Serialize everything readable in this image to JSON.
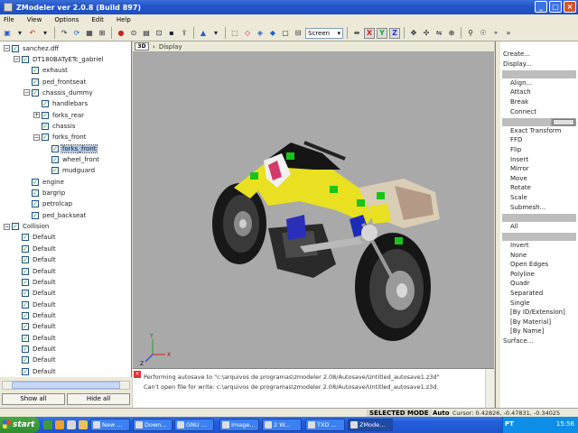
{
  "window": {
    "title": "ZModeler ver 2.0.8 (Build 897)"
  },
  "menu": [
    "File",
    "View",
    "Options",
    "Edit",
    "Help"
  ],
  "toolbar": {
    "screen_select": "Screen",
    "axis_x": "X",
    "axis_y": "Y",
    "axis_z": "Z"
  },
  "tree": {
    "items": [
      {
        "label": "sanchez.dff",
        "level": 0,
        "exp": "−"
      },
      {
        "label": "DT180BATyETc_gabriel",
        "level": 1,
        "exp": "−"
      },
      {
        "label": "exhaust",
        "level": 2,
        "exp": ""
      },
      {
        "label": "ped_frontseat",
        "level": 2,
        "exp": ""
      },
      {
        "label": "chassis_dummy",
        "level": 2,
        "exp": "−"
      },
      {
        "label": "handlebars",
        "level": 3,
        "exp": ""
      },
      {
        "label": "forks_rear",
        "level": 3,
        "exp": "+"
      },
      {
        "label": "chassis",
        "level": 3,
        "exp": ""
      },
      {
        "label": "forks_front",
        "level": 3,
        "exp": "−"
      },
      {
        "label": "forks_front",
        "level": 4,
        "exp": "",
        "selected": true
      },
      {
        "label": "wheel_front",
        "level": 4,
        "exp": ""
      },
      {
        "label": "mudguard",
        "level": 4,
        "exp": ""
      },
      {
        "label": "engine",
        "level": 2,
        "exp": ""
      },
      {
        "label": "bargrip",
        "level": 2,
        "exp": ""
      },
      {
        "label": "petrolcap",
        "level": 2,
        "exp": ""
      },
      {
        "label": "ped_backseat",
        "level": 2,
        "exp": ""
      },
      {
        "label": "Collision",
        "level": 0,
        "exp": "−"
      },
      {
        "label": "Default",
        "level": 1,
        "exp": ""
      },
      {
        "label": "Default",
        "level": 1,
        "exp": ""
      },
      {
        "label": "Default",
        "level": 1,
        "exp": ""
      },
      {
        "label": "Default",
        "level": 1,
        "exp": ""
      },
      {
        "label": "Default",
        "level": 1,
        "exp": ""
      },
      {
        "label": "Default",
        "level": 1,
        "exp": ""
      },
      {
        "label": "Default",
        "level": 1,
        "exp": ""
      },
      {
        "label": "Default",
        "level": 1,
        "exp": ""
      },
      {
        "label": "Default",
        "level": 1,
        "exp": ""
      },
      {
        "label": "Default",
        "level": 1,
        "exp": ""
      },
      {
        "label": "Default",
        "level": 1,
        "exp": ""
      },
      {
        "label": "Default",
        "level": 1,
        "exp": ""
      },
      {
        "label": "Default",
        "level": 1,
        "exp": ""
      },
      {
        "label": "Default",
        "level": 1,
        "exp": ""
      }
    ],
    "show_all": "Show all",
    "hide_all": "Hide all"
  },
  "viewport": {
    "tag": "3D",
    "label": "Display"
  },
  "log": {
    "line1": "Performing autosave to \"c:\\arquivos de programas\\zmodeler 2.08/Autosave/Untitled_autosave1.z3d\"",
    "line2": "Can't open file for write: c:\\arquivos de programas\\zmodeler 2.08/Autosave/Untitled_autosave1.z3d."
  },
  "commands": {
    "top": [
      "Create...",
      "Display..."
    ],
    "modify": [
      "Align...",
      "Attach",
      "Break",
      "Connect"
    ],
    "modify2": [
      "Exact Transform",
      "FFD",
      "Flip",
      "Insert",
      "Mirror",
      "Move",
      "Rotate",
      "Scale",
      "Submesh..."
    ],
    "select": [
      "All"
    ],
    "select2": [
      "Invert",
      "None",
      "Open Edges",
      "Polyline",
      "Quadr",
      "Separated",
      "Single",
      "[By ID/Extension]",
      "[By Material]",
      "[By Name]"
    ],
    "bottom": [
      "Surface..."
    ]
  },
  "status": {
    "mode": "SELECTED MODE",
    "auto": "Auto",
    "cursor": "Cursor: 0.42826, -0.47831, -0.34025"
  },
  "taskbar": {
    "start": "start",
    "buttons": [
      "New ...",
      "Down...",
      "GNU ...",
      "Image...",
      "2 W...",
      "TXD ...",
      "ZMode..."
    ],
    "lang": "PT",
    "clock": "15:56"
  },
  "colors": {
    "title_bar": "#2456c8",
    "viewport_bg": "#a9a9a9",
    "selection": "#adc6e5",
    "bike_yellow": "#e8e020",
    "vertex_green": "#19c419"
  }
}
